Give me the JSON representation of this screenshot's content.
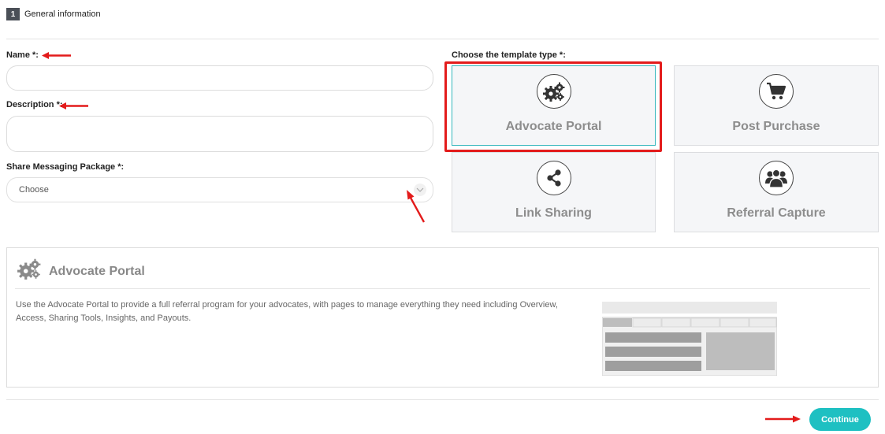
{
  "section": {
    "number": "1",
    "title": "General information"
  },
  "form": {
    "name_label": "Name *:",
    "name_value": "",
    "description_label": "Description *:",
    "description_value": "",
    "package_label": "Share Messaging Package *:",
    "package_selected": "Choose"
  },
  "templates": {
    "label": "Choose the template type *:",
    "items": [
      {
        "label": "Advocate Portal",
        "icon": "gears-icon",
        "selected": true
      },
      {
        "label": "Post Purchase",
        "icon": "cart-icon",
        "selected": false
      },
      {
        "label": "Link Sharing",
        "icon": "share-icon",
        "selected": false
      },
      {
        "label": "Referral Capture",
        "icon": "people-icon",
        "selected": false
      }
    ]
  },
  "preview": {
    "title": "Advocate Portal",
    "icon": "gears-icon",
    "description": "Use the Advocate Portal to provide a full referral program for your advocates, with pages to manage everything they need including Overview, Access, Sharing Tools, Insights, and Payouts."
  },
  "footer": {
    "continue_label": "Continue"
  },
  "colors": {
    "accent": "#1ec0c2",
    "highlight": "#e31b1b",
    "selected_border": "#35b7bc"
  }
}
